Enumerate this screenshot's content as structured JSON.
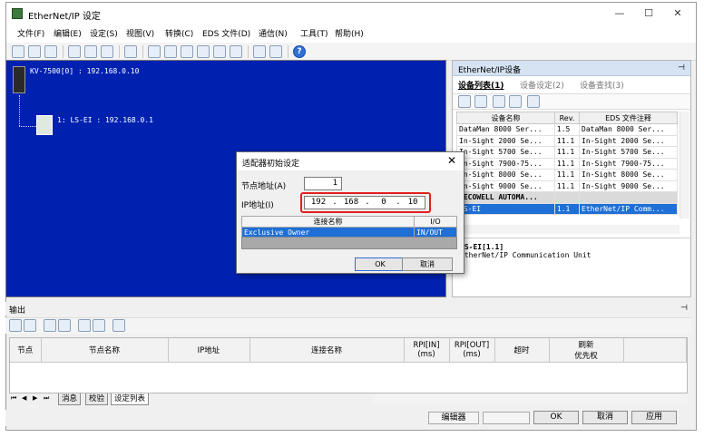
{
  "window": {
    "title": "EtherNet/IP 设定",
    "controls": [
      "—",
      "☐",
      "✕"
    ]
  },
  "menu": [
    "文件(F)",
    "编辑(E)",
    "设定(S)",
    "视图(V)",
    "转换(C)",
    "EDS 文件(D)",
    "通信(N)",
    "工具(T)",
    "帮助(H)"
  ],
  "network": {
    "root_label": "KV-7500[0] : 192.168.0.10",
    "node_label": "1: LS-EI : 192.168.0.1",
    "background": "#0021b0"
  },
  "device_pane": {
    "title": "EtherNet/IP设备",
    "pin": "⊣",
    "tabs": [
      "设备列表(1)",
      "设备设定(2)",
      "设备查找(3)"
    ],
    "columns": [
      "设备名称",
      "Rev.",
      "EDS 文件注释"
    ],
    "rows": [
      {
        "name": "DataMan 8000 Ser...",
        "rev": "1.5",
        "note": "DataMan 8000 Ser..."
      },
      {
        "name": "In-Sight 2000 Se...",
        "rev": "11.1",
        "note": "In-Sight 2000 Se..."
      },
      {
        "name": "In-Sight 5700 Se...",
        "rev": "11.1",
        "note": "In-Sight 5700 Se..."
      },
      {
        "name": "In-Sight 7900-75...",
        "rev": "11.1",
        "note": "In-Sight 7900-75..."
      },
      {
        "name": "In-Sight 8000 Se...",
        "rev": "11.1",
        "note": "In-Sight 8000 Se..."
      },
      {
        "name": "In-Sight 9000 Se...",
        "rev": "11.1",
        "note": "In-Sight 9000 Se..."
      }
    ],
    "group_row": "DECOWELL AUTOMA...",
    "selected_row": {
      "name": "LS-EI",
      "rev": "1.1",
      "note": "EtherNet/IP Comm..."
    },
    "desc_name": "LS-EI[1.1]",
    "desc_text": "EtherNet/IP Communication Unit"
  },
  "dialog": {
    "title": "适配器初始设定",
    "close": "✕",
    "node_addr_label": "节点地址(A)",
    "node_addr_value": "1",
    "ip_label": "IP地址(I)",
    "ip_octets": [
      "192",
      "168",
      "0",
      "10"
    ],
    "conn_columns": [
      "连接名称",
      "I/O"
    ],
    "conn_row": {
      "name": "Exclusive Owner",
      "io": "IN/OUT"
    },
    "ok": "OK",
    "cancel": "取消",
    "highlight_color": "#e02020"
  },
  "output": {
    "title": "输出",
    "pin": "⊣",
    "columns": [
      "节点",
      "节点名称",
      "IP地址",
      "连接名称",
      "RPI[IN]\n(ms)",
      "RPI[OUT]\n(ms)",
      "超时",
      "刷新\n优先权"
    ],
    "tabs": [
      "消息",
      "校验",
      "设定列表"
    ]
  },
  "statusbar": {
    "editor": "编辑器",
    "ok": "OK",
    "cancel": "取消",
    "apply": "应用"
  }
}
